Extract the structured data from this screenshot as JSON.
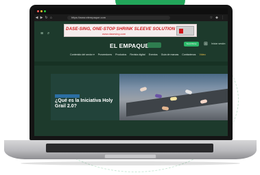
{
  "browser": {
    "url": "https://www.elempaque.com"
  },
  "ad": {
    "headline": "DASE-SING, ONE-STOP SHRINK SLEEVE SOLUTION",
    "sub": "www.dasesing.com"
  },
  "header": {
    "logo": "EL EMPAQUE",
    "badge": "",
    "subscribe_button": "Suscribirse",
    "login_label": "Iniciar sesión"
  },
  "nav": {
    "items": [
      {
        "label": "Contenido del sector ▾",
        "active": false
      },
      {
        "label": "Proveedores",
        "active": false
      },
      {
        "label": "Productos",
        "active": false
      },
      {
        "label": "Revista digital",
        "active": false
      },
      {
        "label": "Eventos",
        "active": false
      },
      {
        "label": "Guía de marcas",
        "active": false
      },
      {
        "label": "Contáctenos",
        "active": false
      },
      {
        "label": "Video",
        "active": true
      }
    ]
  },
  "hero": {
    "category": "",
    "headline": "¿Qué es la Iniciativa Holy Grail 2.0?",
    "dek": ""
  },
  "colors": {
    "site_bg": "#1d3a2c",
    "accent_green": "#2db86a",
    "ad_red": "#d0171a",
    "active_nav": "#f0c24b"
  }
}
